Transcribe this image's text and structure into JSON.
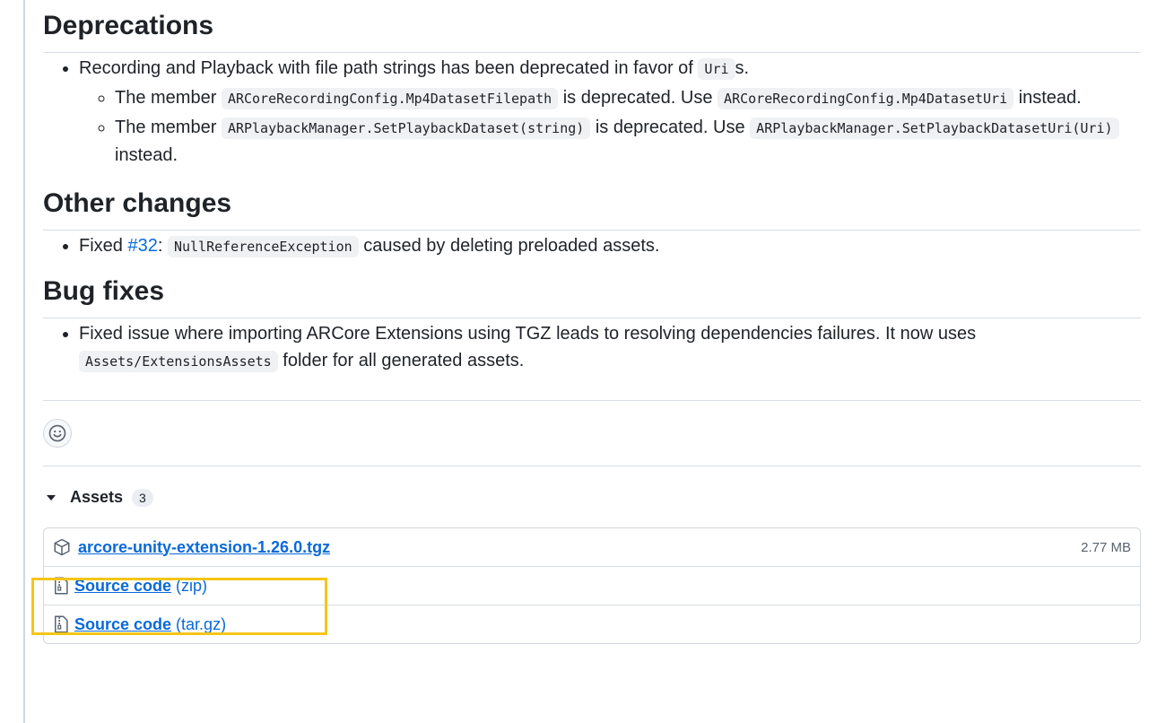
{
  "deprecations": {
    "title": "Deprecations",
    "item1": {
      "pre": "Recording and Playback with file path strings has been deprecated in favor of ",
      "code": "Uri",
      "post": "s."
    },
    "sub1": {
      "pre": "The member ",
      "code1": "ARCoreRecordingConfig.Mp4DatasetFilepath",
      "mid": " is deprecated. Use ",
      "code2": "ARCoreRecordingConfig.Mp4DatasetUri",
      "post": " instead."
    },
    "sub2": {
      "pre": "The member ",
      "code1": "ARPlaybackManager.SetPlaybackDataset(string)",
      "mid": " is deprecated. Use ",
      "code2": "ARPlaybackManager.SetPlaybackDatasetUri(Uri)",
      "post": " instead."
    }
  },
  "other_changes": {
    "title": "Other changes",
    "item1": {
      "pre": "Fixed ",
      "link": "#32",
      "colon": ": ",
      "code": "NullReferenceException",
      "post": " caused by deleting preloaded assets."
    }
  },
  "bug_fixes": {
    "title": "Bug fixes",
    "item1": {
      "pre": "Fixed issue where importing ARCore Extensions using TGZ leads to resolving dependencies failures. It now uses ",
      "code": "Assets/ExtensionsAssets",
      "post": " folder for all generated assets."
    }
  },
  "reactions": {
    "icon": "smiley-icon"
  },
  "assets": {
    "label": "Assets",
    "count": "3",
    "items": [
      {
        "name": "arcore-unity-extension-1.26.0.tgz",
        "suffix": "",
        "size": "2.77 MB",
        "icon": "package-icon"
      },
      {
        "name": "Source code",
        "suffix": "(zip)",
        "size": "",
        "icon": "file-zip-icon"
      },
      {
        "name": "Source code",
        "suffix": "(tar.gz)",
        "size": "",
        "icon": "file-zip-icon"
      }
    ]
  },
  "colors": {
    "link": "#0969da",
    "highlight": "#f5c518",
    "code_bg": "#eff1f3"
  }
}
